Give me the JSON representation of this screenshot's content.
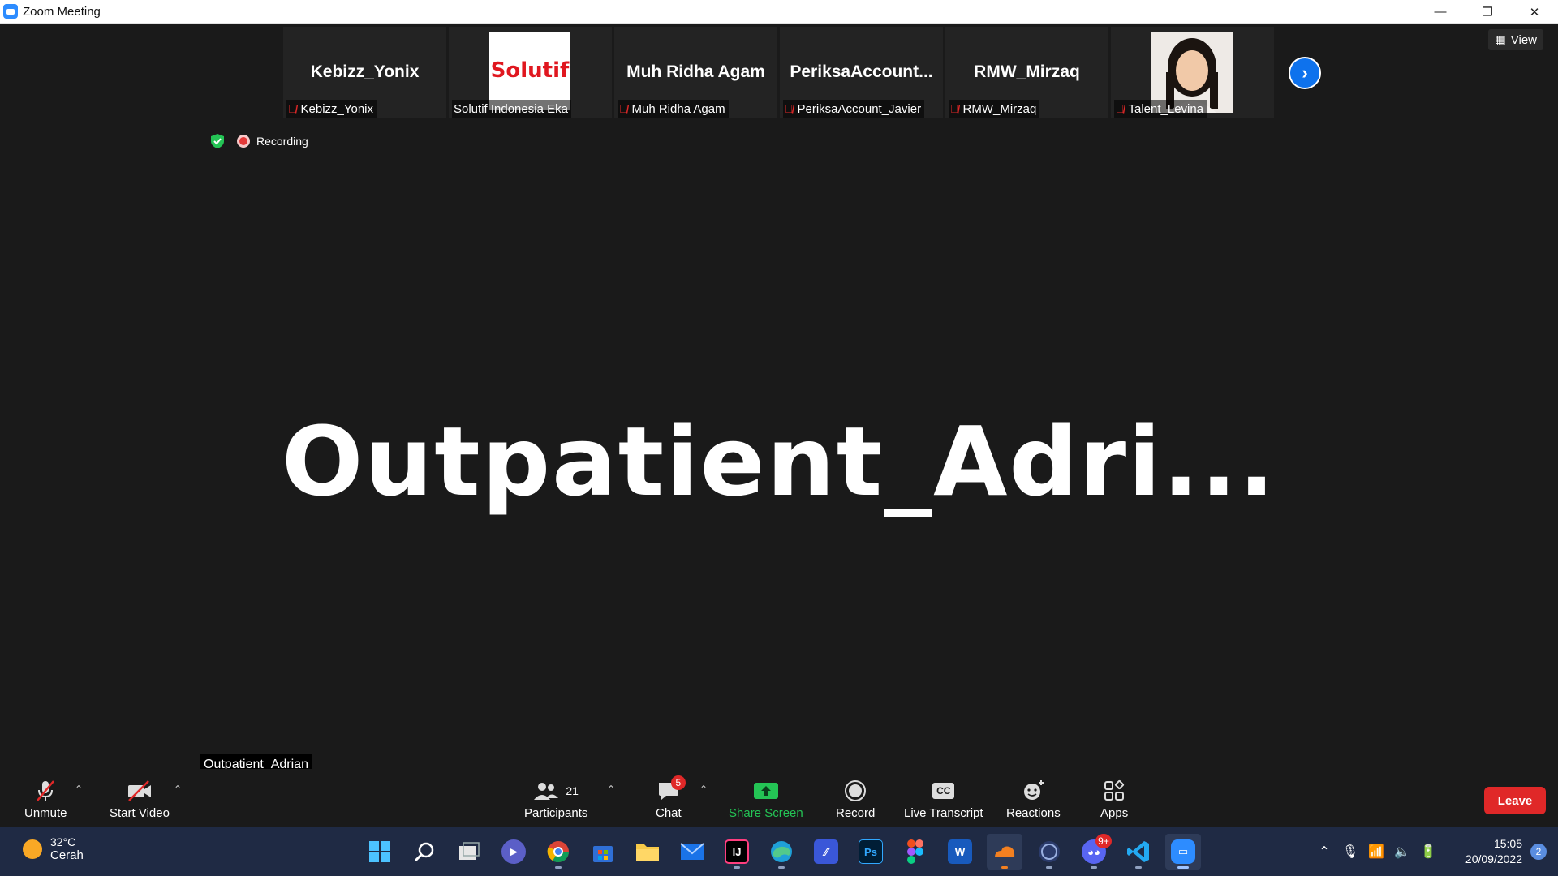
{
  "window": {
    "title": "Zoom Meeting",
    "minimize": "—",
    "restore": "❐",
    "close": "✕"
  },
  "view_button": "View",
  "tiles": [
    {
      "display_name": "Kebizz_Yonix",
      "label": "Kebizz_Yonix",
      "kind": "name",
      "muted": true
    },
    {
      "display_name": "",
      "label": "Solutif Indonesia Eka",
      "kind": "logo",
      "logo_text": "Solutif",
      "muted": false
    },
    {
      "display_name": "Muh Ridha Agam",
      "label": "Muh Ridha Agam",
      "kind": "name",
      "muted": true
    },
    {
      "display_name": "PeriksaAccount...",
      "label": "PeriksaAccount_Javier",
      "kind": "name",
      "muted": true
    },
    {
      "display_name": "RMW_Mirzaq",
      "label": "RMW_Mirzaq",
      "kind": "name",
      "muted": true
    },
    {
      "display_name": "",
      "label": "Talent_Levina",
      "kind": "photo",
      "muted": true
    }
  ],
  "recording_label": "Recording",
  "active_speaker": "Outpatient_Adri...",
  "active_speaker_tag": "Outpatient_Adrian",
  "toolbar": {
    "unmute": "Unmute",
    "start_video": "Start Video",
    "participants": "Participants",
    "participants_count": "21",
    "chat": "Chat",
    "chat_badge": "5",
    "share_screen": "Share Screen",
    "record": "Record",
    "live_transcript": "Live Transcript",
    "reactions": "Reactions",
    "apps": "Apps",
    "leave": "Leave",
    "cc_glyph": "CC"
  },
  "taskbar": {
    "temperature": "32°C",
    "weather_text": "Cerah",
    "time": "15:05",
    "date": "20/09/2022",
    "notification_count": "2",
    "discord_badge": "9+",
    "photoshop_label": "Ps",
    "word_label": "W",
    "jetbrains_label": "IJ",
    "apps": [
      "windows-start",
      "search",
      "task-view",
      "teams-chat",
      "chrome-beta",
      "microsoft-store",
      "file-explorer",
      "mail",
      "intellij",
      "edge",
      "visual-studio",
      "photoshop",
      "figma",
      "word",
      "cloudflare-warp",
      "obs",
      "discord",
      "vscode",
      "zoom"
    ]
  },
  "colors": {
    "accent_blue": "#0e72ed",
    "leave_red": "#e02828",
    "share_green": "#24c455",
    "background": "#1a1a1a",
    "taskbar": "#1f2a44"
  }
}
